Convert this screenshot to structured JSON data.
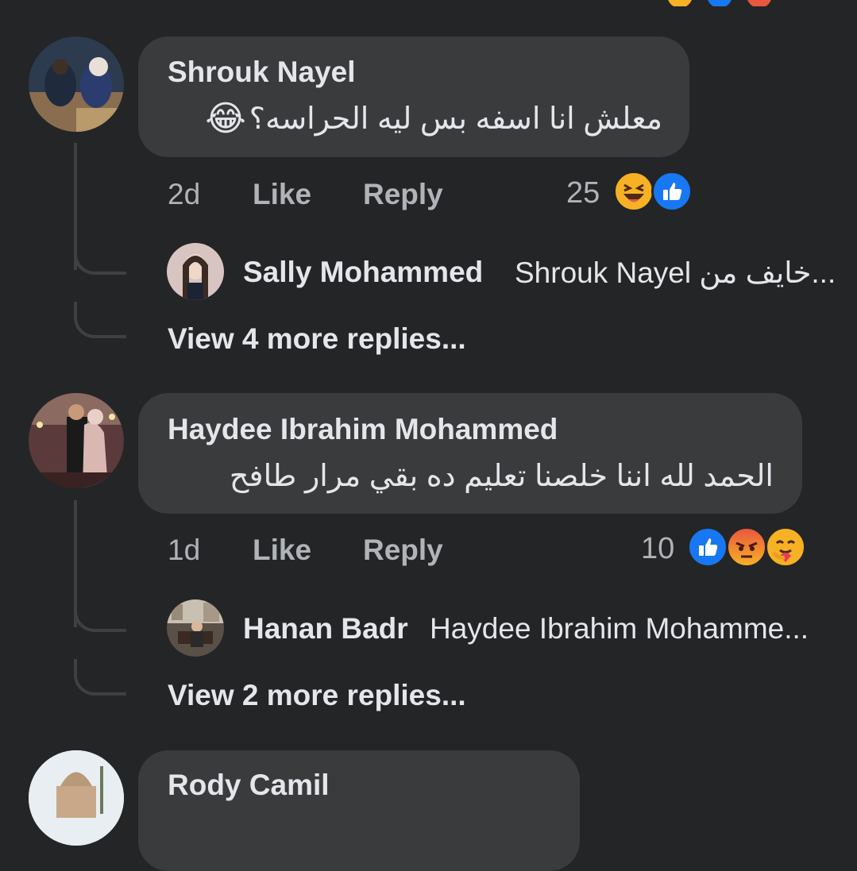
{
  "comments": [
    {
      "author": "Shrouk Nayel",
      "text": "معلش انا اسفه بس ليه الحراسه؟",
      "emoji": "😂",
      "time": "2d",
      "like_label": "Like",
      "reply_label": "Reply",
      "reaction_count": "25",
      "reactions": [
        "haha-icon",
        "like-icon"
      ],
      "reply": {
        "author": "Sally Mohammed",
        "preview": "Shrouk Nayel خايف من..."
      },
      "view_more": "View 4 more replies..."
    },
    {
      "author": "Haydee Ibrahim Mohammed",
      "text": "الحمد لله اننا خلصنا تعليم ده بقي مرار طافح",
      "time": "1d",
      "like_label": "Like",
      "reply_label": "Reply",
      "reaction_count": "10",
      "reactions": [
        "like-icon",
        "angry-icon",
        "care-icon"
      ],
      "reply": {
        "author": "Hanan Badr",
        "preview": "Haydee Ibrahim Mohamme..."
      },
      "view_more": "View 2 more replies..."
    },
    {
      "author": "Rody Camil"
    }
  ],
  "colors": {
    "background": "#242526",
    "bubble": "#3a3b3c",
    "like_blue": "#1877f2",
    "angry_red": "#e9573f",
    "haha_yellow": "#f7b125"
  }
}
